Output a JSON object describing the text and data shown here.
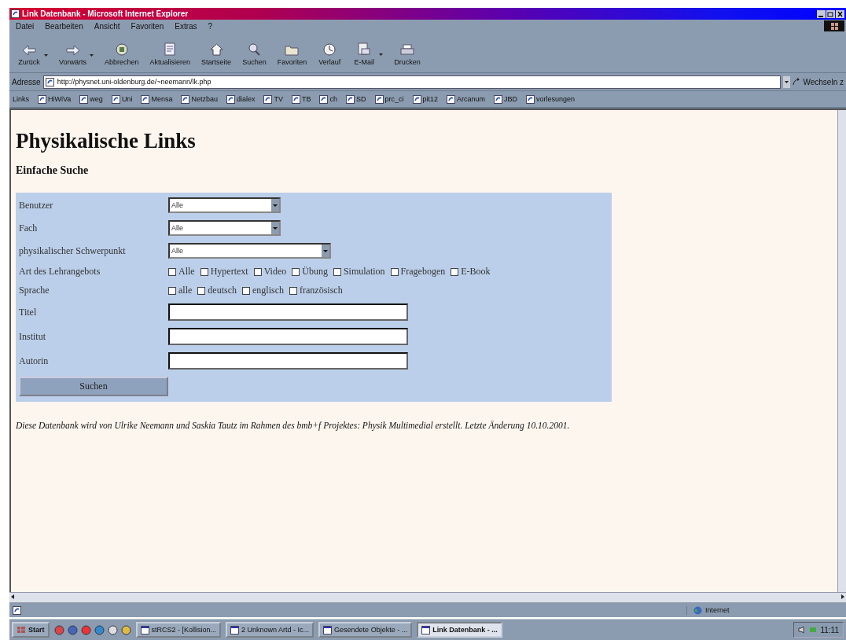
{
  "window": {
    "title": "Link Datenbank - Microsoft Internet Explorer"
  },
  "menu": [
    "Datei",
    "Bearbeiten",
    "Ansicht",
    "Favoriten",
    "Extras",
    "?"
  ],
  "toolbar": [
    {
      "label": "Zurück",
      "dropdown": true
    },
    {
      "label": "Vorwärts",
      "dropdown": true
    },
    {
      "label": "Abbrechen",
      "dropdown": false
    },
    {
      "label": "Aktualisieren",
      "dropdown": false
    },
    {
      "label": "Startseite",
      "dropdown": false
    },
    {
      "label": "Suchen",
      "dropdown": false
    },
    {
      "label": "Favoriten",
      "dropdown": false
    },
    {
      "label": "Verlauf",
      "dropdown": false
    },
    {
      "label": "E-Mail",
      "dropdown": true
    },
    {
      "label": "Drucken",
      "dropdown": false
    }
  ],
  "address": {
    "label": "Adresse",
    "value": "http://physnet.uni-oldenburg.de/~neemann/lk.php",
    "go": "Wechseln z"
  },
  "links": {
    "label": "Links",
    "items": [
      "HiWiVa",
      "weg",
      "Uni",
      "Mensa",
      "Netzbau",
      "dialex",
      "TV",
      "TB",
      "ch",
      "SD",
      "prc_ci",
      "pit12",
      "Arcanum",
      "JBD",
      "vorlesungen"
    ]
  },
  "page": {
    "heading": "Physikalische Links",
    "subheading": "Einfache Suche",
    "form": [
      {
        "kind": "select",
        "label": "Benutzer",
        "value": "Alle"
      },
      {
        "kind": "select",
        "label": "Fach",
        "value": "Alle"
      },
      {
        "kind": "select",
        "label": "physikalischer Schwerpunkt",
        "value": "Alle"
      },
      {
        "kind": "checkboxes",
        "label": "Art des Lehrangebots",
        "options": [
          {
            "label": "Alle",
            "checked": false
          },
          {
            "label": "Hypertext",
            "checked": false
          },
          {
            "label": "Video",
            "checked": false
          },
          {
            "label": "Übung",
            "checked": false
          },
          {
            "label": "Simulation",
            "checked": false
          },
          {
            "label": "Fragebogen",
            "checked": false
          },
          {
            "label": "E-Book",
            "checked": false
          }
        ]
      },
      {
        "kind": "checkboxes",
        "label": "Sprache",
        "options": [
          {
            "label": "alle",
            "checked": false
          },
          {
            "label": "deutsch",
            "checked": false
          },
          {
            "label": "englisch",
            "checked": false
          },
          {
            "label": "französisch",
            "checked": false
          }
        ]
      },
      {
        "kind": "text",
        "label": "Titel"
      },
      {
        "kind": "text",
        "label": "Institut"
      },
      {
        "kind": "text",
        "label": "Autorin"
      }
    ],
    "submit": "Suchen",
    "footer": "Diese Datenbank wird von Ulrike Neemann und Saskia Tautz im Rahmen des bmb+f Projektes: Physik Multimedial erstellt. Letzte Änderung 10.10.2001."
  },
  "status_bar": {
    "zone": "Internet"
  },
  "taskbar": {
    "start": "Start",
    "tasks": [
      {
        "label": "stRCS2 - [Kollision...",
        "selected": false
      },
      {
        "label": "2 Unknown Artd - Ic...",
        "selected": false
      },
      {
        "label": "Gesendete Objekte - ...",
        "selected": false
      },
      {
        "label": "Link Datenbank - ...",
        "selected": true
      }
    ],
    "clock": "11:11"
  }
}
